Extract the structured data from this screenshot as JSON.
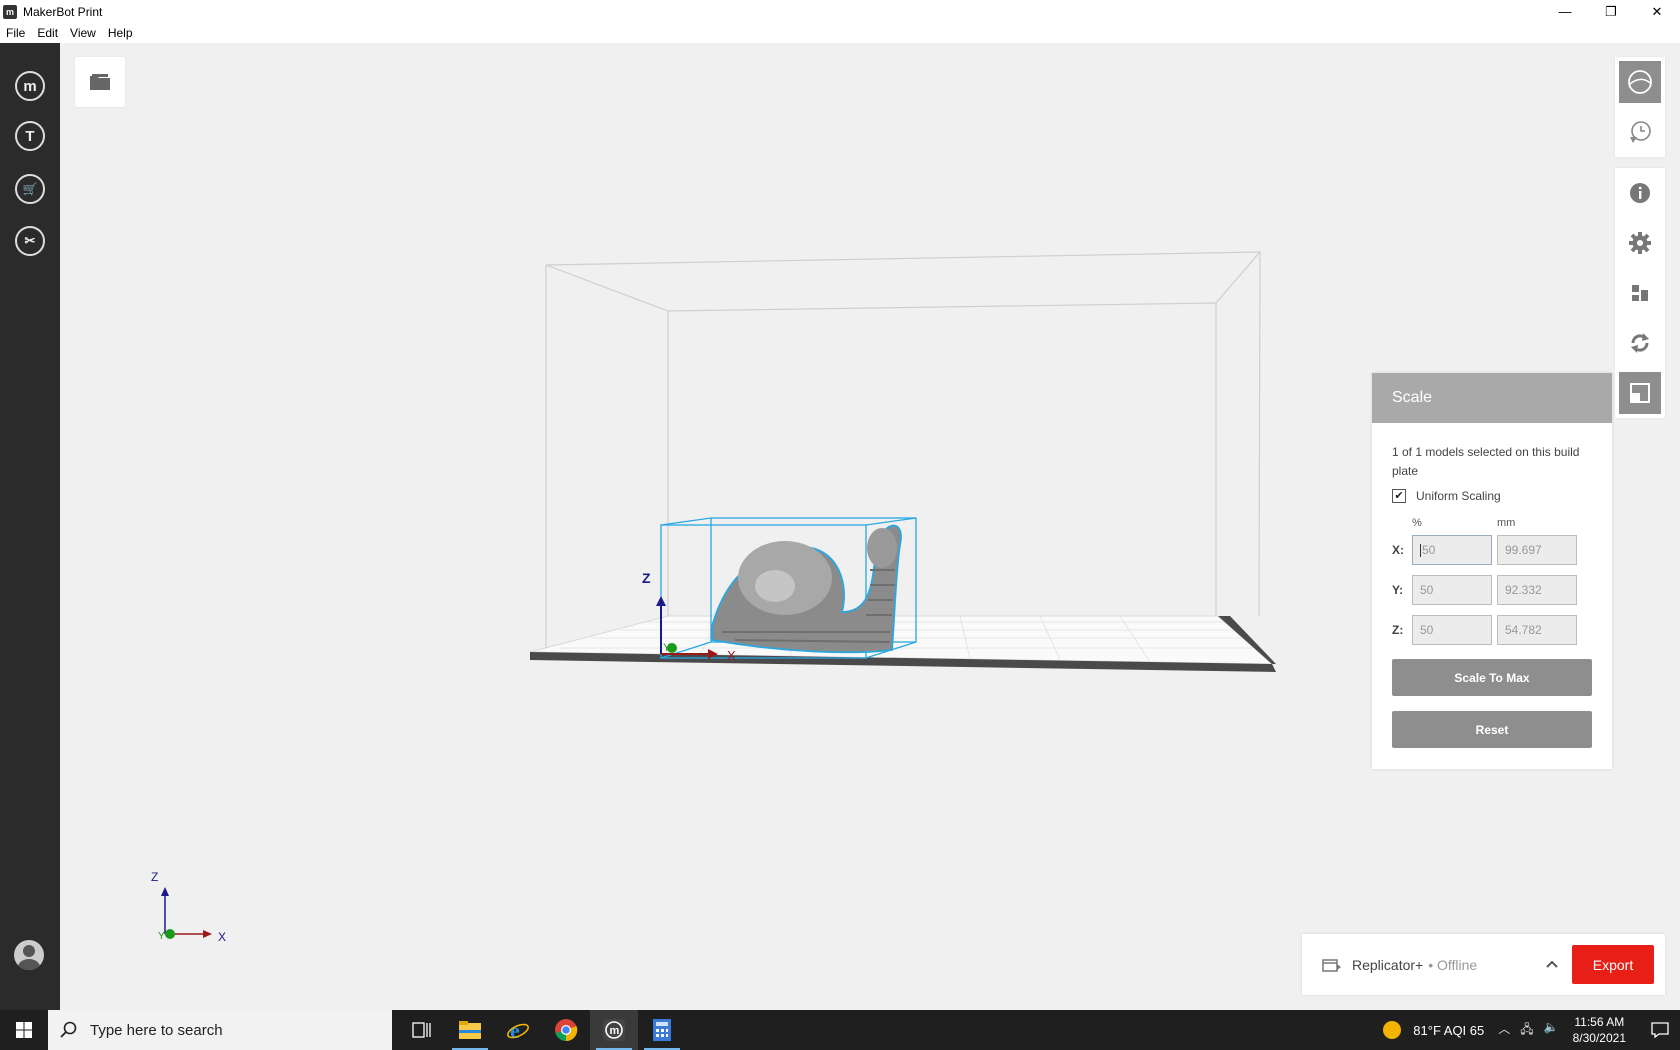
{
  "window": {
    "title": "MakerBot Print",
    "app_icon": "makerbot-m-icon",
    "controls": {
      "minimize": "—",
      "restore": "❐",
      "close": "✕"
    }
  },
  "menu": [
    "File",
    "Edit",
    "View",
    "Help"
  ],
  "leftnav": {
    "items": [
      {
        "name": "makerbot-home",
        "glyph": "m"
      },
      {
        "name": "thingiverse",
        "glyph": "T"
      },
      {
        "name": "store",
        "glyph": "🛒"
      },
      {
        "name": "tools",
        "glyph": "✂"
      }
    ]
  },
  "viewport": {
    "model_axes": {
      "z": "Z",
      "x": "X",
      "y": "Y"
    },
    "corner_axes": {
      "z": "Z",
      "x": "X",
      "y": "Y"
    }
  },
  "scale_panel": {
    "title": "Scale",
    "selection_text": "1 of 1 models selected on this build plate",
    "uniform_label": "Uniform Scaling",
    "uniform_checked": true,
    "unit_percent": "%",
    "unit_mm": "mm",
    "rows": [
      {
        "axis": "X:",
        "percent": "50",
        "mm": "99.697"
      },
      {
        "axis": "Y:",
        "percent": "50",
        "mm": "92.332"
      },
      {
        "axis": "Z:",
        "percent": "50",
        "mm": "54.782"
      }
    ],
    "scale_max_label": "Scale To Max",
    "reset_label": "Reset"
  },
  "bottom_bar": {
    "printer": "Replicator+",
    "status": "• Offline",
    "export_label": "Export"
  },
  "taskbar": {
    "search_placeholder": "Type here to search",
    "weather": "81°F  AQI 65",
    "time": "11:56 AM",
    "date": "8/30/2021"
  },
  "colors": {
    "accent_red": "#e81f17",
    "selection_blue": "#29a8e0",
    "panel_header": "#a9a9a9"
  }
}
